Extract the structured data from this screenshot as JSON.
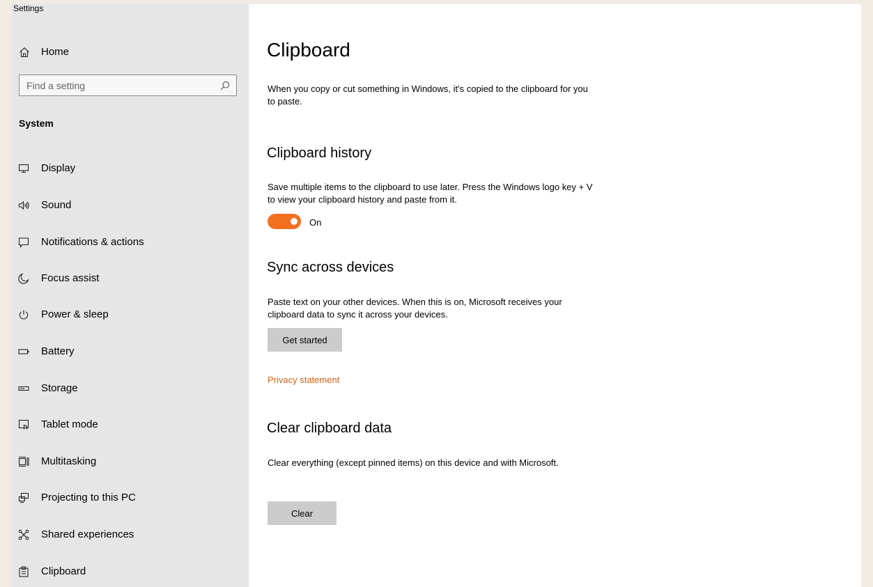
{
  "window": {
    "title": "Settings"
  },
  "sidebar": {
    "home_label": "Home",
    "search_placeholder": "Find a setting",
    "section_label": "System",
    "items": [
      {
        "label": "Display",
        "icon": "monitor-icon"
      },
      {
        "label": "Sound",
        "icon": "speaker-icon"
      },
      {
        "label": "Notifications & actions",
        "icon": "notification-icon"
      },
      {
        "label": "Focus assist",
        "icon": "moon-icon"
      },
      {
        "label": "Power & sleep",
        "icon": "power-icon"
      },
      {
        "label": "Battery",
        "icon": "battery-icon"
      },
      {
        "label": "Storage",
        "icon": "storage-icon"
      },
      {
        "label": "Tablet mode",
        "icon": "tablet-mode-icon"
      },
      {
        "label": "Multitasking",
        "icon": "multitasking-icon"
      },
      {
        "label": "Projecting to this PC",
        "icon": "projecting-icon"
      },
      {
        "label": "Shared experiences",
        "icon": "shared-experiences-icon"
      },
      {
        "label": "Clipboard",
        "icon": "clipboard-icon"
      }
    ]
  },
  "main": {
    "title": "Clipboard",
    "intro": "When you copy or cut something in Windows, it's copied to the clipboard for you to paste.",
    "history": {
      "heading": "Clipboard history",
      "description": "Save multiple items to the clipboard to use later. Press the Windows logo key + V to view your clipboard history and paste from it.",
      "toggle_state": "On",
      "toggle_on": true
    },
    "sync": {
      "heading": "Sync across devices",
      "description": "Paste text on your other devices. When this is on, Microsoft receives your clipboard data to sync it across your devices.",
      "button_label": "Get started",
      "link_label": "Privacy statement"
    },
    "clear": {
      "heading": "Clear clipboard data",
      "description": "Clear everything (except pinned items) on this device and with Microsoft.",
      "button_label": "Clear"
    }
  },
  "colors": {
    "accent": "#f37021",
    "link": "#d06016",
    "sidebar_bg": "#e6e6e6",
    "button_bg": "#cccccc"
  }
}
